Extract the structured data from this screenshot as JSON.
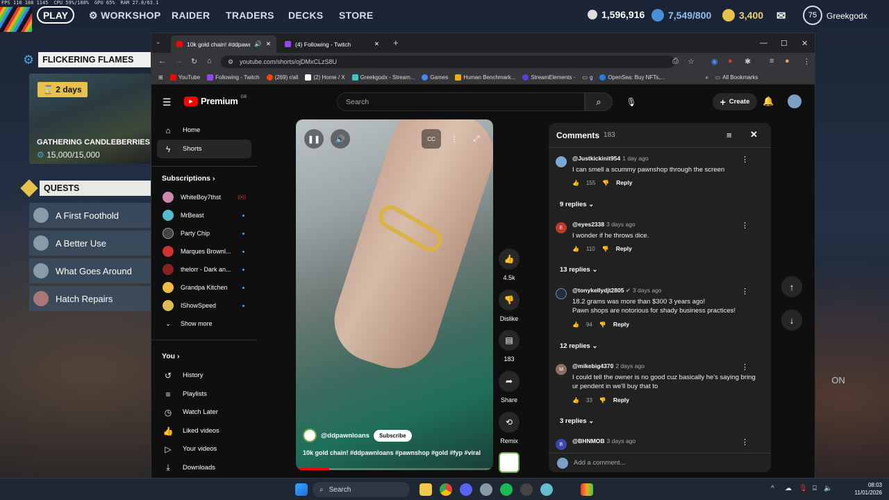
{
  "system_stats": {
    "fps": "FPS 118 188 1145",
    "cpu": "CPU 59%/188%",
    "gpu": "GPU 65%",
    "ram": "RAM 27.8/63.1"
  },
  "game": {
    "play_label": "PLAY",
    "nav": [
      "WORKSHOP",
      "RAIDER",
      "TRADERS",
      "DECKS",
      "STORE"
    ],
    "currency_1": "1,596,916",
    "currency_2": "7,549/800",
    "currency_3": "3,400",
    "level": "75",
    "username": "Greekgodx",
    "event_title": "FLICKERING FLAMES",
    "event_days": "2 days",
    "event_item": "GATHERING CANDLEBERRIES",
    "event_progress": "15,000/15,000",
    "quests_title": "QUESTS",
    "quests": [
      "A First Foothold",
      "A Better Use",
      "What Goes Around",
      "Hatch Repairs"
    ],
    "toggle_on": "ON"
  },
  "browser": {
    "tabs": [
      {
        "title": "10k gold chain! #ddpawnlo"
      },
      {
        "title": "(4) Following - Twitch"
      }
    ],
    "url": "youtube.com/shorts/ojDMxCLzS8U",
    "bookmarks": [
      "YouTube",
      "Following - Twitch",
      "(269) r/all",
      "(2) Home / X",
      "Greekgodx - Stream...",
      "Games",
      "Human Benchmark...",
      "StreamElements -",
      "g",
      "OpenSea: Buy NFTs,...",
      "All Bookmarks"
    ]
  },
  "youtube": {
    "logo": "Premium",
    "region": "GB",
    "search_placeholder": "Search",
    "create_label": "Create",
    "sidebar": {
      "main": [
        {
          "label": "Home",
          "icon": "home-icon"
        },
        {
          "label": "Shorts",
          "icon": "shorts-icon"
        }
      ],
      "subscriptions_title": "Subscriptions",
      "subscriptions": [
        "WhiteBoy7thst",
        "MrBeast",
        "Party Chip",
        "Marques Brownl...",
        "thelorr - Dark an...",
        "Grandpa Kitchen",
        "IShowSpeed"
      ],
      "show_more": "Show more",
      "you_title": "You",
      "you": [
        {
          "label": "History",
          "icon": "history-icon"
        },
        {
          "label": "Playlists",
          "icon": "playlists-icon"
        },
        {
          "label": "Watch Later",
          "icon": "watch-later-icon"
        },
        {
          "label": "Liked videos",
          "icon": "thumbs-up-icon"
        },
        {
          "label": "Your videos",
          "icon": "your-videos-icon"
        },
        {
          "label": "Downloads",
          "icon": "download-icon"
        }
      ]
    },
    "short": {
      "channel": "@ddpawnloans",
      "subscribe_label": "Subscribe",
      "caption": "10k gold chain! #ddpawnloans #pawnshop #gold #fyp #viral",
      "cc_label": "CC",
      "likes": "4.5k",
      "dislike_label": "Dislike",
      "comments_count": "183",
      "share_label": "Share",
      "remix_label": "Remix",
      "progress_fraction": 0.17
    },
    "comments": {
      "title": "Comments",
      "count": "183",
      "add_placeholder": "Add a comment...",
      "reply_label": "Reply",
      "items": [
        {
          "user": "@Justkickinit954",
          "time": "1 day ago",
          "text": "I can smell a scummy pawnshop through the screen",
          "likes": "155",
          "replies": "9 replies"
        },
        {
          "user": "@eyes2338",
          "time": "3 days ago",
          "text": "I wonder if he throws dice.",
          "likes": "110",
          "replies": "13 replies",
          "initial": "E"
        },
        {
          "user": "@tonykellydjt2805",
          "time": "3 days ago",
          "text": "18.2 grams was more than $300 3 years ago!\nPawn shops are notorious for shady business practices!",
          "likes": "94",
          "replies": "12 replies"
        },
        {
          "user": "@mikebig4370",
          "time": "2 days ago",
          "text": "I could tell the owner is no good cuz basically he's saying bring ur pendent in we'll buy that to",
          "likes": "33",
          "replies": "3 replies",
          "initial": "M"
        },
        {
          "user": "@BHNMOB",
          "time": "3 days ago",
          "initial": "B"
        }
      ]
    }
  },
  "taskbar": {
    "search_label": "Search",
    "time": "08:03",
    "date": "11/01/2026"
  },
  "colors": {
    "yt_red": "#ff0000",
    "accent_blue": "#3ea6ff",
    "gold": "#e6c24a"
  }
}
